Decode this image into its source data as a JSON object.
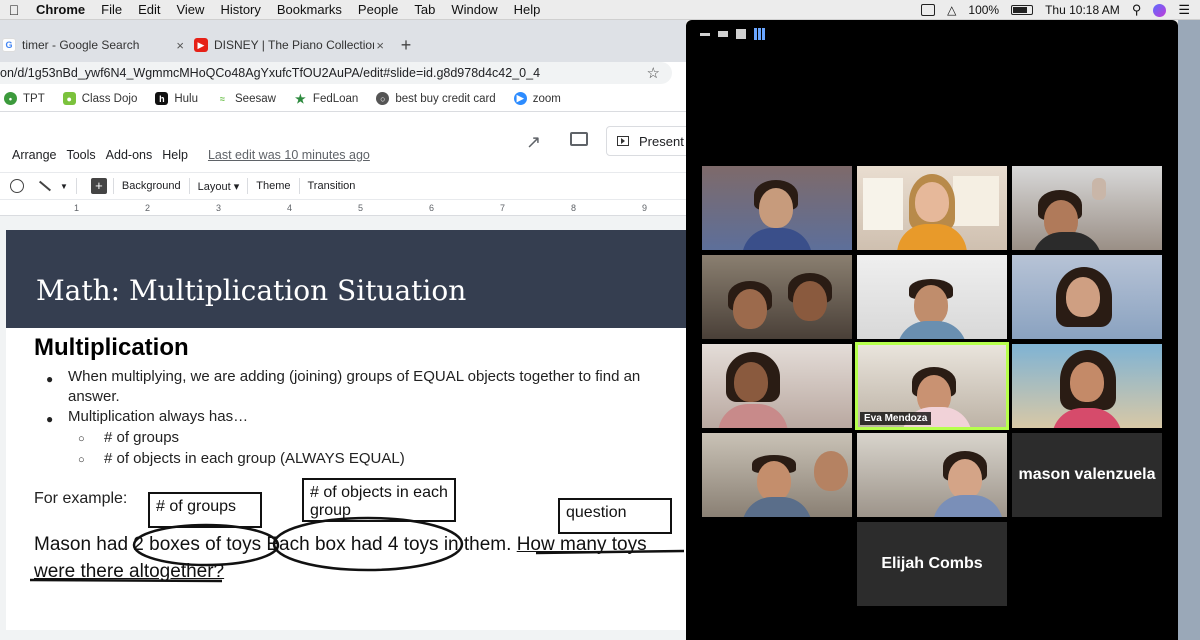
{
  "menubar": {
    "app": "Chrome",
    "items": [
      "File",
      "Edit",
      "View",
      "History",
      "Bookmarks",
      "People",
      "Tab",
      "Window",
      "Help"
    ],
    "battery": "100%",
    "clock": "Thu 10:18 AM"
  },
  "browser": {
    "tabs": [
      {
        "title": "timer - Google Search",
        "icon": "google-icon"
      },
      {
        "title": "DISNEY | The Piano Collections",
        "icon": "youtube-icon"
      }
    ],
    "url": "on/d/1g53nBd_ywf6N4_WgmmcMHoQCo48AgYxufcTfOU2AuPA/edit#slide=id.g8d978d4c42_0_4",
    "bookmarks": [
      "TPT",
      "Class Dojo",
      "Hulu",
      "Seesaw",
      "FedLoan",
      "best buy credit card",
      "zoom"
    ]
  },
  "slides_app": {
    "menus": [
      "Arrange",
      "Tools",
      "Add-ons",
      "Help"
    ],
    "last_edit": "Last edit was 10 minutes ago",
    "present_label": "Present",
    "toolbar": [
      "Background",
      "Layout",
      "Theme",
      "Transition"
    ],
    "ruler_marks": [
      "1",
      "2",
      "3",
      "4",
      "5",
      "6",
      "7",
      "8",
      "9"
    ]
  },
  "slide": {
    "title": "Math: Multiplication Situation",
    "heading": "Multiplication",
    "bullet1_line1": "When multiplying, we are adding (joining) groups of EQUAL objects together to find an",
    "bullet1_line2": "answer.",
    "bullet2": "Multiplication always has…",
    "sub1": "# of groups",
    "sub2": "# of objects in each group (ALWAYS EQUAL)",
    "example_label": "For example:",
    "box_groups": "# of groups",
    "box_objects": "# of objects in each group",
    "box_question": "question",
    "sentence_p1": "Mason had",
    "sentence_p2": "2 boxes of toys",
    "sentence_p3": "Each box had 4 toys",
    "sentence_p4": "in them.",
    "sentence_p5": "How many toys",
    "sentence_line2": "were there altogether?"
  },
  "zoom": {
    "speaking_name": "Eva Mendoza",
    "name_tiles": [
      "mason valenzuela",
      "Elijah Combs"
    ]
  }
}
